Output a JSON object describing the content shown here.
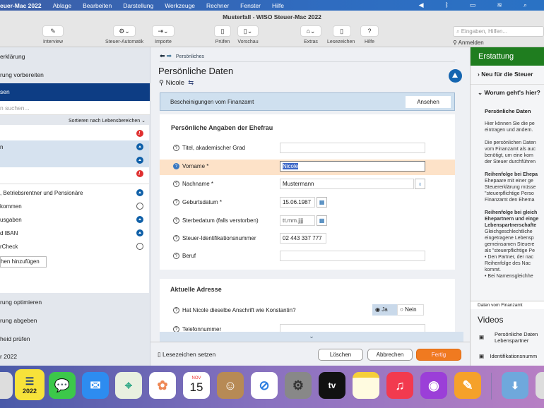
{
  "menubar": {
    "app": "euer-Mac 2022",
    "items": [
      "Ablage",
      "Bearbeiten",
      "Darstellung",
      "Werkzeuge",
      "Rechner",
      "Fenster",
      "Hilfe"
    ]
  },
  "window_title": "Musterfall - WISO Steuer-Mac 2022",
  "toolbar": {
    "interview": "Interview",
    "automatik": "Steuer-Automatik",
    "importe": "Importe",
    "pruefen": "Prüfen",
    "vorschau": "Vorschau",
    "extras": "Extras",
    "lesezeichen": "Lesezeichen",
    "hilfe": "Hilfe",
    "search_placeholder": "Eingaben, Hilfen...",
    "anmelden": "Anmelden"
  },
  "sidebar": {
    "top": [
      "erklärung",
      "rung vorbereiten"
    ],
    "selected": "sen",
    "search_placeholder": "n suchen...",
    "sort": "Sortieren nach Lebensbereichen",
    "rows": [
      {
        "label": "",
        "status": "red"
      },
      {
        "label": "n",
        "status": "blue"
      },
      {
        "label": "",
        "status": "blue"
      },
      {
        "label": "",
        "status": "red"
      },
      {
        "label": ", Betriebsrentner und Pensionäre",
        "status": "blue"
      },
      {
        "label": "kommen",
        "status": "empty"
      },
      {
        "label": "usgaben",
        "status": "blue"
      },
      {
        "label": "d IBAN",
        "status": "blue"
      },
      {
        "label": "rCheck",
        "status": "empty"
      }
    ],
    "add_button": "hen hinzufügen",
    "bottom": [
      "rung optimieren",
      "rung abgeben",
      "heid prüfen",
      "r 2022"
    ]
  },
  "main": {
    "breadcrumb": "Persönliches",
    "title": "Persönliche Daten",
    "person": "Nicole",
    "banner": {
      "text": "Bescheinigungen vom Finanzamt",
      "button": "Ansehen"
    },
    "section1": {
      "title": "Persönliche Angaben der Ehefrau",
      "fields": [
        {
          "label": "Titel, akademischer Grad",
          "value": ""
        },
        {
          "label": "Vorname *",
          "value": "Nicole"
        },
        {
          "label": "Nachname *",
          "value": "Mustermann"
        },
        {
          "label": "Geburtsdatum *",
          "value": "15.06.1987"
        },
        {
          "label": "Sterbedatum (falls verstorben)",
          "value": "tt.mm.jjjj"
        },
        {
          "label": "Steuer-Identifikationsnummer",
          "value": "02 443 337 777"
        },
        {
          "label": "Beruf",
          "value": ""
        }
      ]
    },
    "section2": {
      "title": "Aktuelle Adresse",
      "question": "Hat Nicole dieselbe Anschrift wie Konstantin?",
      "yes": "Ja",
      "no": "Nein",
      "phone": "Telefonnummer"
    },
    "bottom": {
      "bookmark": "Lesezeichen setzen",
      "delete": "Löschen",
      "cancel": "Abbrechen",
      "done": "Fertig"
    }
  },
  "right": {
    "header": "Erstattung",
    "item1": "Neu für die Steuer",
    "item2": "Worum geht's hier?",
    "heading": "Persönliche Daten",
    "paras": [
      "Hier können Sie die pe",
      "eintragen und ändern.",
      "",
      "Die persönlichen Daten",
      "vom Finanzamt als auc",
      "benötigt, um eine kom",
      "der Steuer durchführen",
      "",
      "Reihenfolge bei Ehepa",
      "Ehepaare mit einer ge",
      "Steuererklärung müsse",
      "\"steuerpflichtige Perso",
      "Finanzamt den Ehema",
      "",
      "Reihenfolge bei gleich",
      "Ehepartnern und einge",
      "Lebenspartnerschafte",
      "Gleichgeschlechtliche",
      "eingetragene Lebensp",
      "gemeinsamen Steuere",
      "als \"steuerpflichtige Pe",
      "• Den Partner, der nac",
      "  Reihenfolge des Nac",
      "  kommt.",
      "• Bei Namensgleichhe"
    ],
    "source": "Daten vom Finanzamt",
    "videos": "Videos",
    "video1": "Persönliche Daten Lebenspartner",
    "video2": "Identifikationsnumm"
  },
  "dock": {
    "wiso_year": "2022",
    "cal_month": "NOV",
    "cal_day": "15",
    "tv": "tv"
  },
  "colors": {
    "accent": "#0d3d84",
    "green": "#1f7d1f",
    "orange": "#f07a20"
  }
}
